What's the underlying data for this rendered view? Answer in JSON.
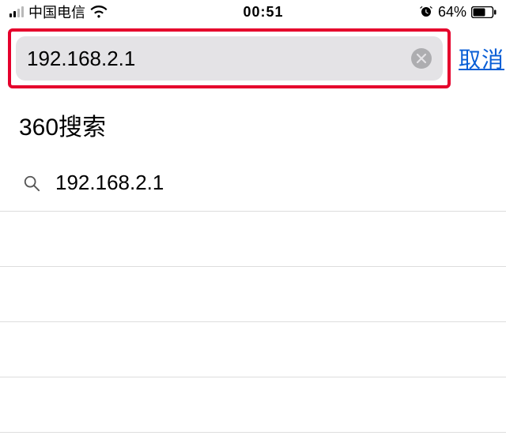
{
  "status_bar": {
    "carrier": "中国电信",
    "time": "00:51",
    "battery_pct": "64%"
  },
  "search": {
    "value": "192.168.2.1",
    "cancel_label": "取消"
  },
  "section": {
    "title": "360搜索"
  },
  "suggestions": [
    {
      "label": "192.168.2.1"
    },
    {
      "label": ""
    },
    {
      "label": ""
    },
    {
      "label": ""
    },
    {
      "label": ""
    }
  ]
}
